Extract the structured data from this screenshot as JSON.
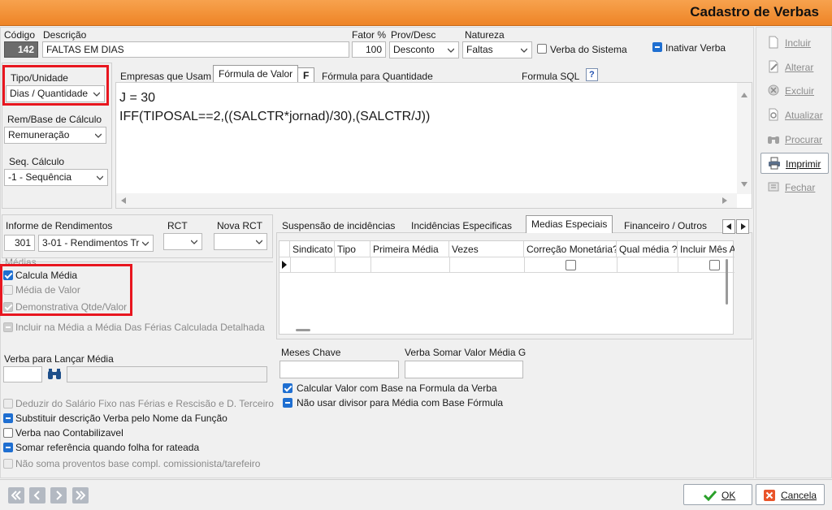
{
  "window": {
    "title": "Cadastro de Verbas"
  },
  "header": {
    "codigo_label": "Código",
    "codigo_value": "142",
    "descricao_label": "Descrição",
    "descricao_value": "FALTAS EM DIAS",
    "fator_label": "Fator %",
    "fator_value": "100",
    "provdesc_label": "Prov/Desc",
    "provdesc_value": "Desconto",
    "natureza_label": "Natureza",
    "natureza_value": "Faltas",
    "verba_sistema_label": "Verba do Sistema",
    "inativar_label": "Inativar Verba"
  },
  "left": {
    "tipo_label": "Tipo/Unidade",
    "tipo_value": "Dias / Quantidade",
    "rem_label": "Rem/Base de Cálculo",
    "rem_value": "Remuneração",
    "seq_label": "Seq. Cálculo",
    "seq_value": "-1 - Sequência"
  },
  "formula_tabs": {
    "empresas": "Empresas que Usam",
    "formula_valor": "Fórmula de Valor",
    "f_button": "F",
    "formula_qtd": "Fórmula para Quantidade",
    "formula_sql": "Formula SQL",
    "help_button": "?"
  },
  "formula": {
    "line1": "J = 30",
    "line2": "IFF(TIPOSAL==2,((SALCTR*jornad)/30),(SALCTR/J))"
  },
  "informe": {
    "label": "Informe de Rendimentos",
    "code": "301",
    "value": "3-01 - Rendimentos Tr",
    "rct_label": "RCT",
    "nova_rct_label": "Nova RCT"
  },
  "medias": {
    "group_label": "Médias",
    "calcula_media": "Calcula Média",
    "media_valor": "Média de Valor",
    "demonstrativa": "Demonstrativa Qtde/Valor",
    "incluir_ferias": "Incluir na Média a Média Das Férias Calculada Detalhada",
    "verba_lancar_label": "Verba para Lançar Média"
  },
  "options": {
    "deduzir": "Deduzir do Salário Fixo nas  Férias e Rescisão e D. Terceiro",
    "substituir": "Substituir descrição Verba pelo Nome da Função",
    "nao_contabilizavel": "Verba nao Contabilizavel",
    "somar_referencia": "Somar referência quando folha for rateada",
    "nao_soma": "Não soma proventos base compl. comissionista/tarefeiro"
  },
  "right_tabs": {
    "suspensao": "Suspensão de incidências",
    "incidencias": "Incidências Especificas",
    "medias_especiais": "Medias Especiais",
    "financeiro": "Financeiro / Outros"
  },
  "grid": {
    "columns": [
      "Sindicato",
      "Tipo",
      "Primeira Média",
      "Vezes",
      "Correção Monetária?",
      "Qual média ?",
      "Incluir Mês A"
    ]
  },
  "meses": {
    "meses_chave_label": "Meses Chave",
    "verba_somar_label": "Verba Somar Valor Média G",
    "calcular_valor": "Calcular Valor com Base na Formula da Verba",
    "nao_usar_divisor": "Não usar divisor para Média com Base Fórmula"
  },
  "sidebar": {
    "incluir": "Incluir",
    "alterar": "Alterar",
    "excluir": "Excluir",
    "atualizar": "Atualizar",
    "procurar": "Procurar",
    "imprimir": "Imprimir",
    "fechar": "Fechar"
  },
  "footer": {
    "ok": "OK",
    "cancela": "Cancela"
  },
  "colors": {
    "title_orange": "#ee8426",
    "accent_blue": "#1f6fd1",
    "highlight_red": "#e8161f"
  }
}
